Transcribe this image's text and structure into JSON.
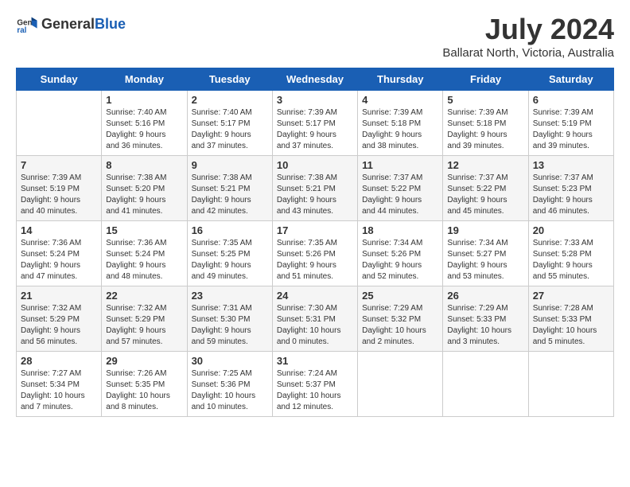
{
  "header": {
    "logo_general": "General",
    "logo_blue": "Blue",
    "title": "July 2024",
    "subtitle": "Ballarat North, Victoria, Australia"
  },
  "days_of_week": [
    "Sunday",
    "Monday",
    "Tuesday",
    "Wednesday",
    "Thursday",
    "Friday",
    "Saturday"
  ],
  "weeks": [
    [
      {
        "day": "",
        "info": ""
      },
      {
        "day": "1",
        "info": "Sunrise: 7:40 AM\nSunset: 5:16 PM\nDaylight: 9 hours\nand 36 minutes."
      },
      {
        "day": "2",
        "info": "Sunrise: 7:40 AM\nSunset: 5:17 PM\nDaylight: 9 hours\nand 37 minutes."
      },
      {
        "day": "3",
        "info": "Sunrise: 7:39 AM\nSunset: 5:17 PM\nDaylight: 9 hours\nand 37 minutes."
      },
      {
        "day": "4",
        "info": "Sunrise: 7:39 AM\nSunset: 5:18 PM\nDaylight: 9 hours\nand 38 minutes."
      },
      {
        "day": "5",
        "info": "Sunrise: 7:39 AM\nSunset: 5:18 PM\nDaylight: 9 hours\nand 39 minutes."
      },
      {
        "day": "6",
        "info": "Sunrise: 7:39 AM\nSunset: 5:19 PM\nDaylight: 9 hours\nand 39 minutes."
      }
    ],
    [
      {
        "day": "7",
        "info": "Sunrise: 7:39 AM\nSunset: 5:19 PM\nDaylight: 9 hours\nand 40 minutes."
      },
      {
        "day": "8",
        "info": "Sunrise: 7:38 AM\nSunset: 5:20 PM\nDaylight: 9 hours\nand 41 minutes."
      },
      {
        "day": "9",
        "info": "Sunrise: 7:38 AM\nSunset: 5:21 PM\nDaylight: 9 hours\nand 42 minutes."
      },
      {
        "day": "10",
        "info": "Sunrise: 7:38 AM\nSunset: 5:21 PM\nDaylight: 9 hours\nand 43 minutes."
      },
      {
        "day": "11",
        "info": "Sunrise: 7:37 AM\nSunset: 5:22 PM\nDaylight: 9 hours\nand 44 minutes."
      },
      {
        "day": "12",
        "info": "Sunrise: 7:37 AM\nSunset: 5:22 PM\nDaylight: 9 hours\nand 45 minutes."
      },
      {
        "day": "13",
        "info": "Sunrise: 7:37 AM\nSunset: 5:23 PM\nDaylight: 9 hours\nand 46 minutes."
      }
    ],
    [
      {
        "day": "14",
        "info": "Sunrise: 7:36 AM\nSunset: 5:24 PM\nDaylight: 9 hours\nand 47 minutes."
      },
      {
        "day": "15",
        "info": "Sunrise: 7:36 AM\nSunset: 5:24 PM\nDaylight: 9 hours\nand 48 minutes."
      },
      {
        "day": "16",
        "info": "Sunrise: 7:35 AM\nSunset: 5:25 PM\nDaylight: 9 hours\nand 49 minutes."
      },
      {
        "day": "17",
        "info": "Sunrise: 7:35 AM\nSunset: 5:26 PM\nDaylight: 9 hours\nand 51 minutes."
      },
      {
        "day": "18",
        "info": "Sunrise: 7:34 AM\nSunset: 5:26 PM\nDaylight: 9 hours\nand 52 minutes."
      },
      {
        "day": "19",
        "info": "Sunrise: 7:34 AM\nSunset: 5:27 PM\nDaylight: 9 hours\nand 53 minutes."
      },
      {
        "day": "20",
        "info": "Sunrise: 7:33 AM\nSunset: 5:28 PM\nDaylight: 9 hours\nand 55 minutes."
      }
    ],
    [
      {
        "day": "21",
        "info": "Sunrise: 7:32 AM\nSunset: 5:29 PM\nDaylight: 9 hours\nand 56 minutes."
      },
      {
        "day": "22",
        "info": "Sunrise: 7:32 AM\nSunset: 5:29 PM\nDaylight: 9 hours\nand 57 minutes."
      },
      {
        "day": "23",
        "info": "Sunrise: 7:31 AM\nSunset: 5:30 PM\nDaylight: 9 hours\nand 59 minutes."
      },
      {
        "day": "24",
        "info": "Sunrise: 7:30 AM\nSunset: 5:31 PM\nDaylight: 10 hours\nand 0 minutes."
      },
      {
        "day": "25",
        "info": "Sunrise: 7:29 AM\nSunset: 5:32 PM\nDaylight: 10 hours\nand 2 minutes."
      },
      {
        "day": "26",
        "info": "Sunrise: 7:29 AM\nSunset: 5:33 PM\nDaylight: 10 hours\nand 3 minutes."
      },
      {
        "day": "27",
        "info": "Sunrise: 7:28 AM\nSunset: 5:33 PM\nDaylight: 10 hours\nand 5 minutes."
      }
    ],
    [
      {
        "day": "28",
        "info": "Sunrise: 7:27 AM\nSunset: 5:34 PM\nDaylight: 10 hours\nand 7 minutes."
      },
      {
        "day": "29",
        "info": "Sunrise: 7:26 AM\nSunset: 5:35 PM\nDaylight: 10 hours\nand 8 minutes."
      },
      {
        "day": "30",
        "info": "Sunrise: 7:25 AM\nSunset: 5:36 PM\nDaylight: 10 hours\nand 10 minutes."
      },
      {
        "day": "31",
        "info": "Sunrise: 7:24 AM\nSunset: 5:37 PM\nDaylight: 10 hours\nand 12 minutes."
      },
      {
        "day": "",
        "info": ""
      },
      {
        "day": "",
        "info": ""
      },
      {
        "day": "",
        "info": ""
      }
    ]
  ]
}
